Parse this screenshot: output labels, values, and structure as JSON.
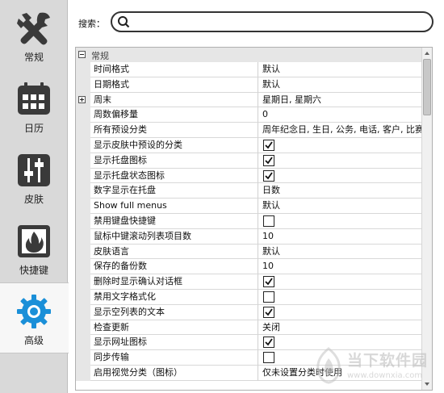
{
  "sidebar": {
    "items": [
      {
        "label": "常规",
        "icon": "tools-icon"
      },
      {
        "label": "日历",
        "icon": "calendar-icon"
      },
      {
        "label": "皮肤",
        "icon": "sliders-icon"
      },
      {
        "label": "快捷键",
        "icon": "flame-icon"
      },
      {
        "label": "高级",
        "icon": "gear-icon",
        "active": true
      }
    ]
  },
  "search": {
    "label": "搜索：",
    "value": "",
    "placeholder": ""
  },
  "grid": {
    "category": "常规",
    "rows": [
      {
        "name": "时间格式",
        "value": "默认"
      },
      {
        "name": "日期格式",
        "value": "默认"
      },
      {
        "name": "周末",
        "value": "星期日, 星期六",
        "expandable": true
      },
      {
        "name": "周数偏移量",
        "value": "0"
      },
      {
        "name": "所有预设分类",
        "value": "周年纪念日, 生日, 公务, 电话, 客户, 比赛, 顾"
      },
      {
        "name": "显示皮肤中预设的分类",
        "checked": true
      },
      {
        "name": "显示托盘图标",
        "checked": true
      },
      {
        "name": "显示托盘状态图标",
        "checked": true
      },
      {
        "name": "数字显示在托盘",
        "value": "日数"
      },
      {
        "name": "Show full menus",
        "value": "默认"
      },
      {
        "name": "禁用键盘快捷键",
        "checked": false
      },
      {
        "name": "鼠标中键滚动列表项目数",
        "value": "10"
      },
      {
        "name": "皮肤语言",
        "value": "默认"
      },
      {
        "name": "保存的备份数",
        "value": "10"
      },
      {
        "name": "删除时显示确认对话框",
        "checked": true
      },
      {
        "name": "禁用文字格式化",
        "checked": false
      },
      {
        "name": "显示空列表的文本",
        "checked": true
      },
      {
        "name": "检查更新",
        "value": "关闭"
      },
      {
        "name": "显示网址图标",
        "checked": true
      },
      {
        "name": "同步传输",
        "checked": false
      },
      {
        "name": "启用视觉分类（图标）",
        "value": "仅未设置分类时使用"
      }
    ]
  },
  "watermark": {
    "brand": "当下软件园",
    "url": "www.downxia.com"
  },
  "colors": {
    "accent_blue": "#1a8fd8",
    "icon_dark": "#3a3a3a",
    "sidebar_bg": "#d9d9d9"
  }
}
